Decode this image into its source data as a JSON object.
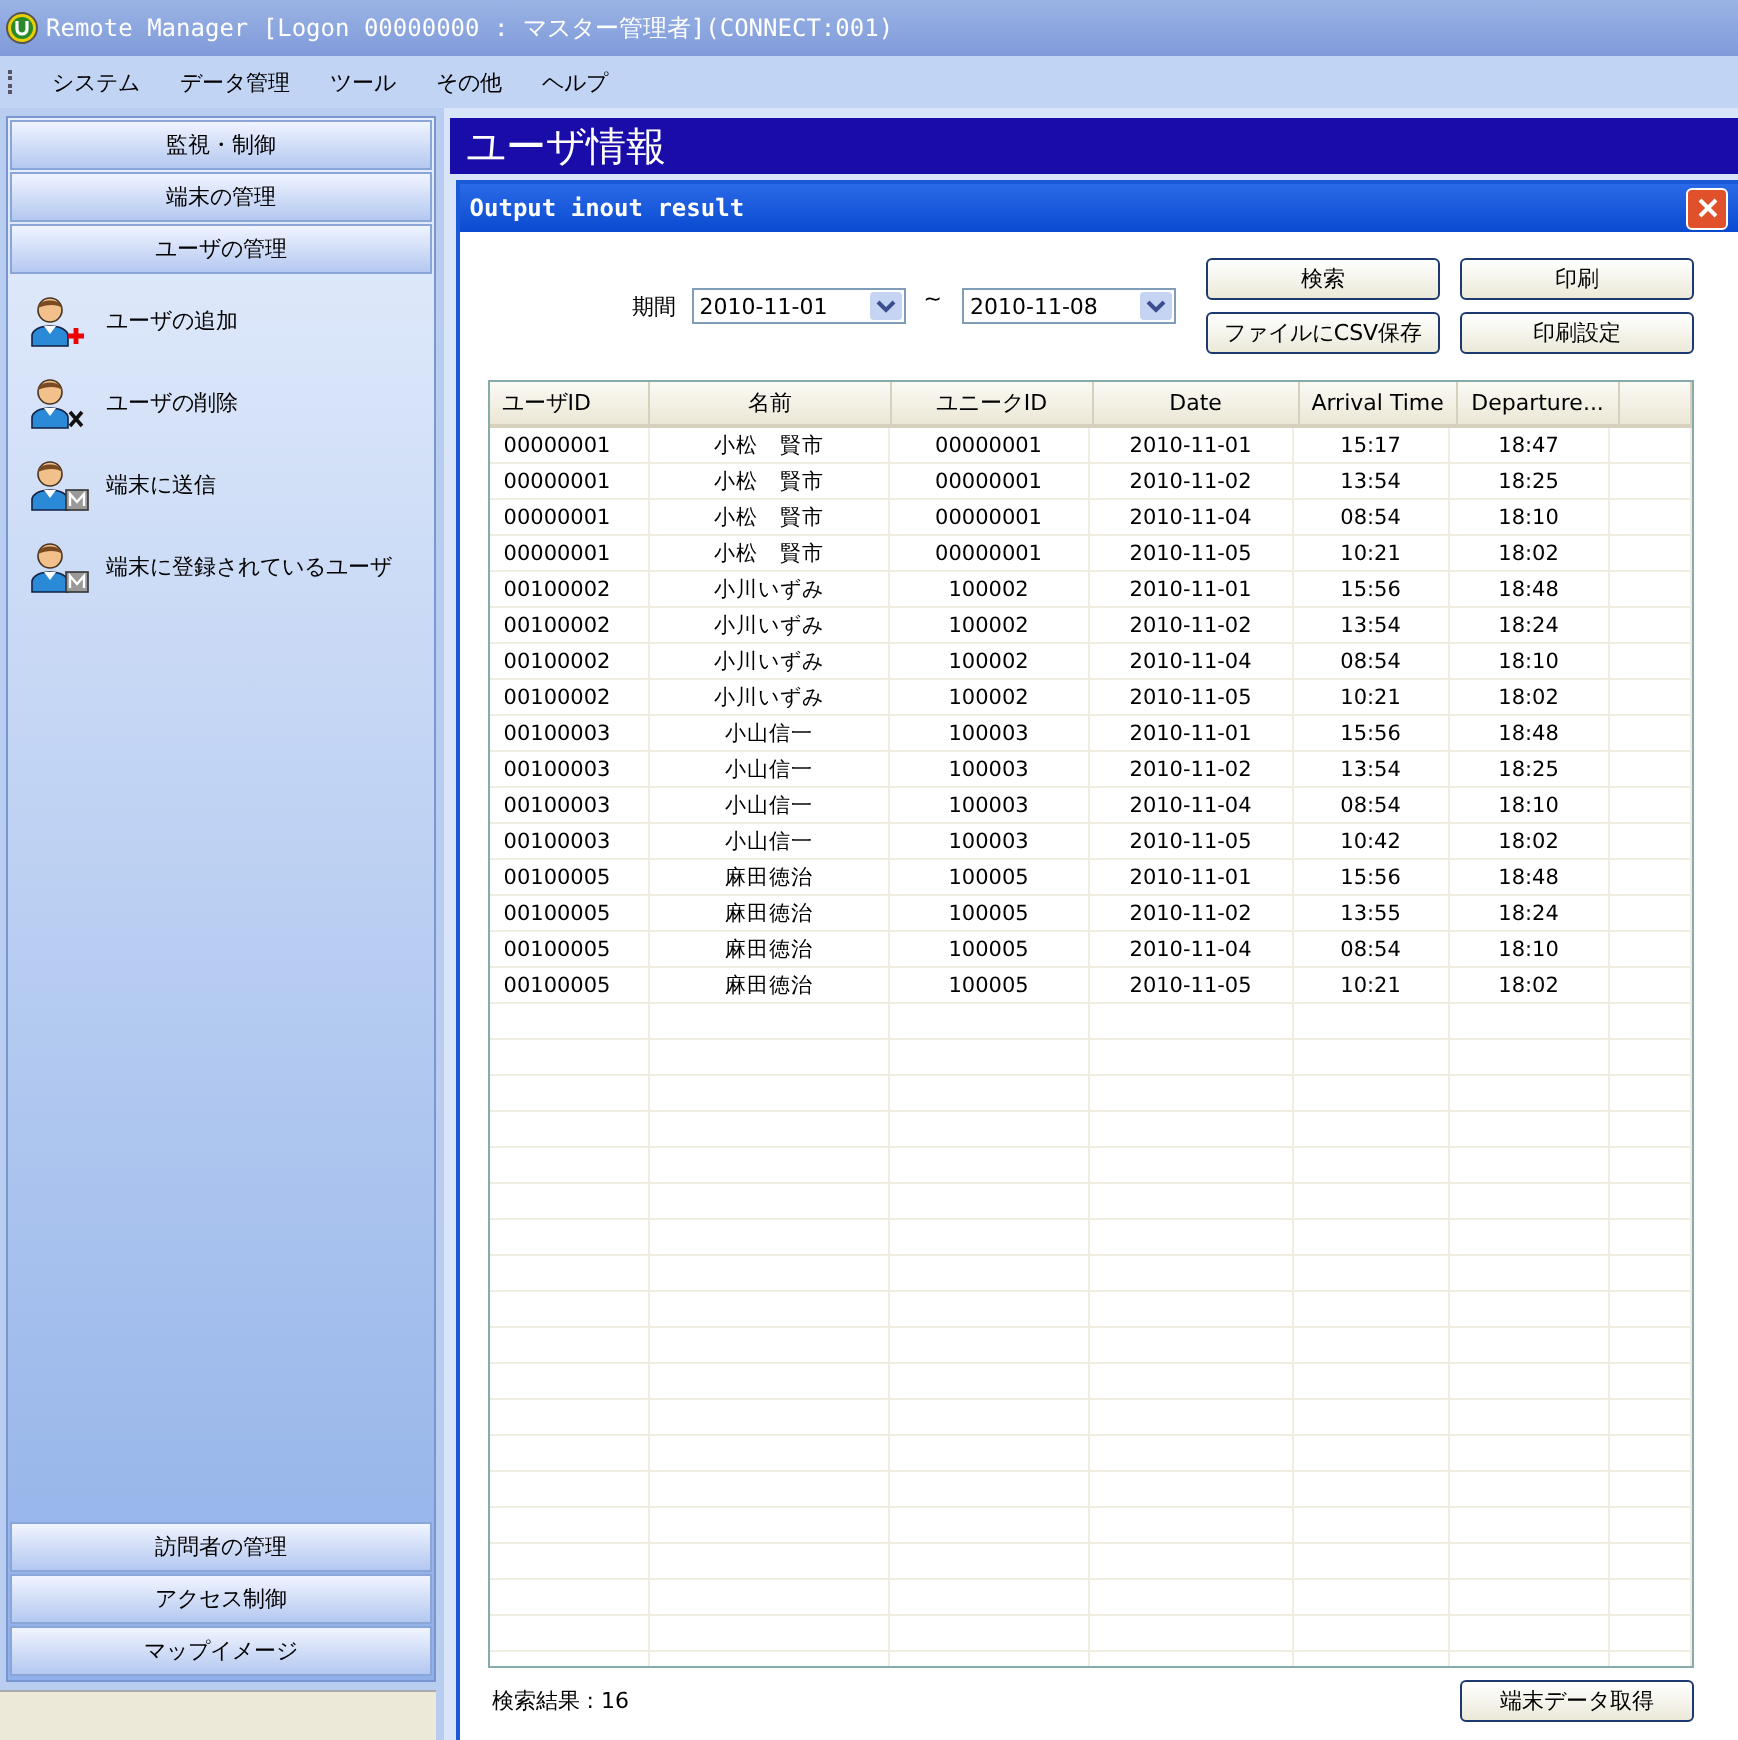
{
  "window": {
    "title": "Remote Manager [Logon 00000000 : マスター管理者](CONNECT:001)"
  },
  "menu": [
    "システム",
    "データ管理",
    "ツール",
    "その他",
    "ヘルプ"
  ],
  "sidebar": {
    "top_sections": [
      "監視・制御",
      "端末の管理",
      "ユーザの管理"
    ],
    "items": [
      {
        "label": "ユーザの追加",
        "kind": "add"
      },
      {
        "label": "ユーザの削除",
        "kind": "delete"
      },
      {
        "label": "端末に送信",
        "kind": "send"
      },
      {
        "label": "端末に登録されているユーザ",
        "kind": "send"
      }
    ],
    "bottom_sections": [
      "訪問者の管理",
      "アクセス制御",
      "マップイメージ"
    ]
  },
  "page_title": "ユーザ情報",
  "dialog": {
    "title": "Output inout result",
    "period_label": "期間",
    "from": "2010-11-01",
    "separator": "~",
    "to": "2010-11-08",
    "buttons": [
      "検索",
      "印刷",
      "ファイルにCSV保存",
      "印刷設定"
    ],
    "table": {
      "columns": [
        "ユーザID",
        "名前",
        "ユニークID",
        "Date",
        "Arrival Time",
        "Departure..."
      ],
      "rows": [
        [
          "00000001",
          "小松　賢市",
          "00000001",
          "2010-11-01",
          "15:17",
          "18:47"
        ],
        [
          "00000001",
          "小松　賢市",
          "00000001",
          "2010-11-02",
          "13:54",
          "18:25"
        ],
        [
          "00000001",
          "小松　賢市",
          "00000001",
          "2010-11-04",
          "08:54",
          "18:10"
        ],
        [
          "00000001",
          "小松　賢市",
          "00000001",
          "2010-11-05",
          "10:21",
          "18:02"
        ],
        [
          "00100002",
          "小川いずみ",
          "100002",
          "2010-11-01",
          "15:56",
          "18:48"
        ],
        [
          "00100002",
          "小川いずみ",
          "100002",
          "2010-11-02",
          "13:54",
          "18:24"
        ],
        [
          "00100002",
          "小川いずみ",
          "100002",
          "2010-11-04",
          "08:54",
          "18:10"
        ],
        [
          "00100002",
          "小川いずみ",
          "100002",
          "2010-11-05",
          "10:21",
          "18:02"
        ],
        [
          "00100003",
          "小山信一",
          "100003",
          "2010-11-01",
          "15:56",
          "18:48"
        ],
        [
          "00100003",
          "小山信一",
          "100003",
          "2010-11-02",
          "13:54",
          "18:25"
        ],
        [
          "00100003",
          "小山信一",
          "100003",
          "2010-11-04",
          "08:54",
          "18:10"
        ],
        [
          "00100003",
          "小山信一",
          "100003",
          "2010-11-05",
          "10:42",
          "18:02"
        ],
        [
          "00100005",
          "麻田徳治",
          "100005",
          "2010-11-01",
          "15:56",
          "18:48"
        ],
        [
          "00100005",
          "麻田徳治",
          "100005",
          "2010-11-02",
          "13:55",
          "18:24"
        ],
        [
          "00100005",
          "麻田徳治",
          "100005",
          "2010-11-04",
          "08:54",
          "18:10"
        ],
        [
          "00100005",
          "麻田徳治",
          "100005",
          "2010-11-05",
          "10:21",
          "18:02"
        ]
      ]
    },
    "result_count": "検索結果 : 16",
    "fetch_button": "端末データ取得"
  }
}
